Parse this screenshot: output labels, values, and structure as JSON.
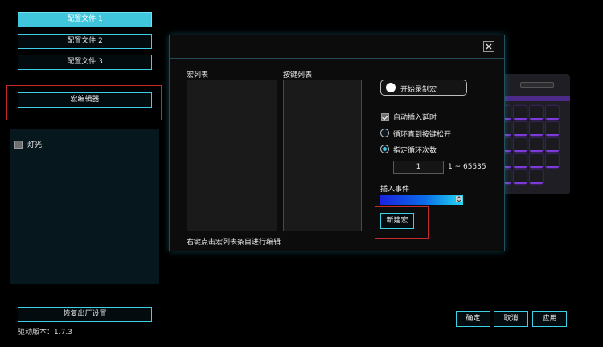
{
  "profiles": [
    {
      "label": "配置文件 1",
      "active": true
    },
    {
      "label": "配置文件 2",
      "active": false
    },
    {
      "label": "配置文件 3",
      "active": false
    }
  ],
  "macro_editor_label": "宏编辑器",
  "light": {
    "label": "灯光",
    "checked": false
  },
  "restore_label": "恢复出厂设置",
  "driver_version": "驱动版本：1.7.3",
  "dialog": {
    "close_icon": "close-icon",
    "macro_list_title": "宏列表",
    "key_list_title": "按键列表",
    "hint": "右键点击宏列表条目进行编辑",
    "record_label": "开始录制宏",
    "auto_insert_delay": "自动插入延时",
    "loop_until_release": "循环直到按键松开",
    "specified_loops": "指定循环次数",
    "loop_count": "1",
    "loop_range": "1 ~ 65535",
    "insert_event_label": "插入事件",
    "new_macro_label": "新建宏"
  },
  "footer": {
    "ok": "确定",
    "cancel": "取消",
    "apply": "应用"
  },
  "colors": {
    "accent": "#3fd0e8",
    "highlight": "#c42a2a",
    "keyboard_glow": "#7a3bd6"
  }
}
